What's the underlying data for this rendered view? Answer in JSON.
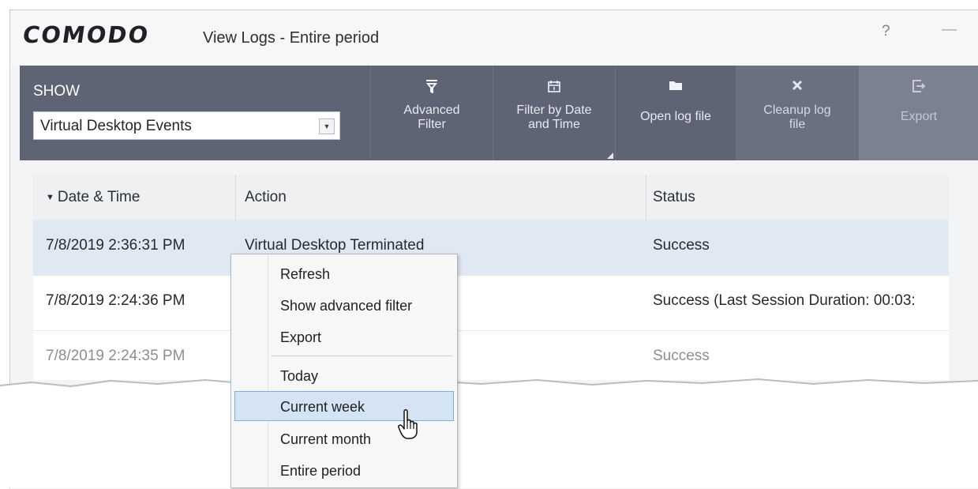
{
  "window": {
    "logo": "COMODO",
    "title": "View Logs - Entire period",
    "help_label": "?",
    "minimize_label": "—"
  },
  "toolbar": {
    "show_label": "SHOW",
    "show_selected": "Virtual Desktop Events",
    "buttons": [
      {
        "label_line1": "Advanced",
        "label_line2": "Filter",
        "icon": "funnel-icon"
      },
      {
        "label_line1": "Filter by Date",
        "label_line2": "and Time",
        "icon": "calendar-icon"
      },
      {
        "label_line1": "Open log file",
        "label_line2": "",
        "icon": "folder-icon"
      },
      {
        "label_line1": "Cleanup log",
        "label_line2": "file",
        "icon": "x-icon"
      },
      {
        "label_line1": "Export",
        "label_line2": "",
        "icon": "export-icon"
      }
    ]
  },
  "table": {
    "columns": [
      "Date & Time",
      "Action",
      "Status"
    ],
    "rows": [
      {
        "datetime": "7/8/2019 2:36:31 PM",
        "action": "Virtual Desktop Terminated",
        "status": "Success"
      },
      {
        "datetime": "7/8/2019 2:24:36 PM",
        "action": "",
        "status": "Success (Last Session Duration: 00:03:"
      },
      {
        "datetime": "7/8/2019 2:24:35 PM",
        "action": "",
        "status": "Success"
      }
    ]
  },
  "context_menu": {
    "items": [
      "Refresh",
      "Show advanced filter",
      "Export",
      "Today",
      "Current week",
      "Current month",
      "Entire period"
    ],
    "highlighted": "Current week"
  },
  "colors": {
    "toolbar_bg": "#5e6474",
    "selected_row": "#dfe8f3",
    "menu_highlight": "#d5e4f4"
  }
}
